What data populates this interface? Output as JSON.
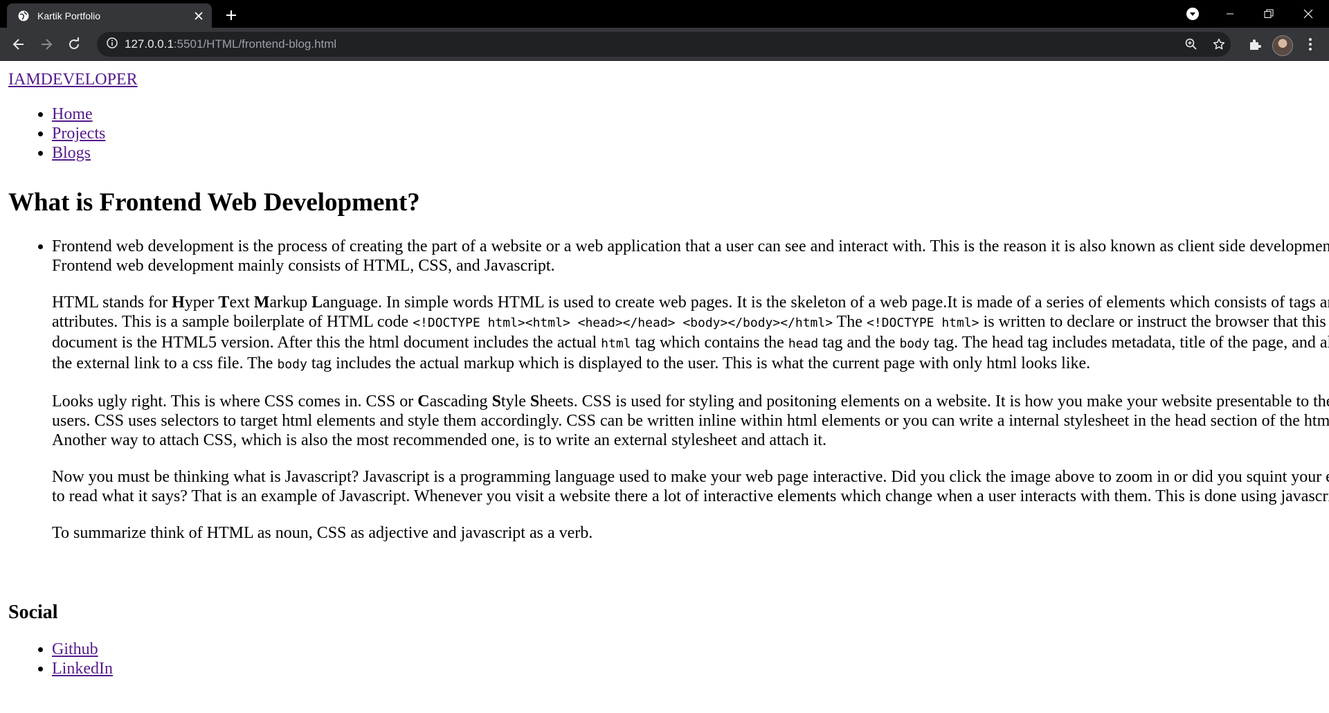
{
  "browser": {
    "tab_title": "Kartik Portfolio",
    "url_host": "127.0.0.1",
    "url_rest": ":5501/HTML/frontend-blog.html"
  },
  "site": {
    "logo": "IAMDEVELOPER",
    "nav": [
      "Home",
      "Projects",
      "Blogs"
    ]
  },
  "article": {
    "title": "What is Frontend Web Development?",
    "p1": "Frontend web development is the process of creating the part of a website or a web application that a user can see and interact with. This is the reason it is also known as client side development. Frontend web development mainly consists of HTML, CSS, and Javascript.",
    "p2": {
      "t1": "HTML stands for ",
      "b1": "H",
      "t2": "yper ",
      "b2": "T",
      "t3": "ext ",
      "b3": "M",
      "t4": "arkup ",
      "b4": "L",
      "t5": "anguage. In simple words HTML is used to create web pages. It is the skeleton of a web page.It is made of a series of elements which consists of tags and attributes. This is a sample boilerplate of HTML code ",
      "code1": "<!DOCTYPE html><html> <head></head> <body></body></html>",
      "t6": " The ",
      "code2": "<!DOCTYPE html>",
      "t7": " is written to declare or instruct the browser that this document is the HTML5 version. After this the html document includes the actual ",
      "code3": "html",
      "t8": " tag which contains the ",
      "code4": "head",
      "t9": " tag and the ",
      "code5": "body",
      "t10": " tag. The head tag includes metadata, title of the page, and also the external link to a css file. The ",
      "code6": "body",
      "t11": " tag includes the actual markup which is displayed to the user. This is what the current page with only html looks like."
    },
    "p3": {
      "t1": "Looks ugly right. This is where CSS comes in. CSS or ",
      "b1": "C",
      "t2": "ascading ",
      "b2": "S",
      "t3": "tyle ",
      "b3": "S",
      "t4": "heets. CSS is used for styling and positoning elements on a website. It is how you make your website presentable to the users. CSS uses selectors to target html elements and style them accordingly. CSS can be written inline within html elements or you can write a internal stylesheet in the head section of the html. Another way to attach CSS, which is also the most recommended one, is to write an external stylesheet and attach it."
    },
    "p4": "Now you must be thinking what is Javascript? Javascript is a programming language used to make your web page interactive. Did you click the image above to zoom in or did you squint your eyes to read what it says? That is an example of Javascript. Whenever you visit a website there a lot of interactive elements which change when a user interacts with them. This is done using javascript.",
    "p5": "To summarize think of HTML as noun, CSS as adjective and javascript as a verb."
  },
  "social": {
    "heading": "Social",
    "links": [
      "Github",
      "LinkedIn"
    ]
  }
}
